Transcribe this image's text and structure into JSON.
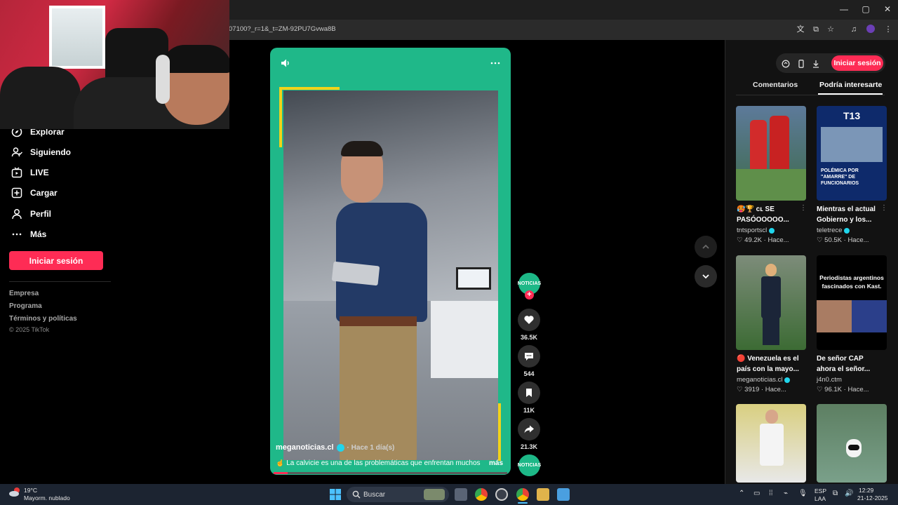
{
  "browser": {
    "url_fragment": "07100?_r=1&_t=ZM-92PU7Gvwa8B"
  },
  "sidebar": {
    "items": [
      {
        "label": "Explorar",
        "icon": "compass-icon"
      },
      {
        "label": "Siguiendo",
        "icon": "following-icon"
      },
      {
        "label": "LIVE",
        "icon": "live-icon"
      },
      {
        "label": "Cargar",
        "icon": "upload-icon"
      },
      {
        "label": "Perfil",
        "icon": "profile-icon"
      },
      {
        "label": "Más",
        "icon": "more-icon"
      }
    ],
    "login_label": "Iniciar sesión",
    "links": [
      "Empresa",
      "Programa",
      "Términos y políticas"
    ],
    "copyright": "© 2025 TikTok"
  },
  "video": {
    "author": "meganoticias.cl",
    "time": "· Hace 1 día(s)",
    "caption": "☝️ La calvicie es una de las problemáticas que enfrentan muchos",
    "more_label": "más",
    "progress": 0.06
  },
  "actions": {
    "avatar_text": "NOTICIAS",
    "likes": "36.5K",
    "comments": "544",
    "saves": "11K",
    "shares": "21.3K"
  },
  "right_panel": {
    "login_label": "Iniciar sesión",
    "tabs": [
      "Comentarios",
      "Podría interesarte"
    ],
    "active_tab": "Podría interesarte",
    "cards": [
      {
        "title": "🥵🏆 cʟ SE PASÓOOOOO...",
        "author": "tntsportscl",
        "verified": true,
        "likes": "49.2K",
        "time": "Hace..."
      },
      {
        "title": "Mientras el actual Gobierno y los...",
        "author": "teletrece",
        "verified": true,
        "likes": "50.5K",
        "time": "Hace...",
        "thumb_text": "T13",
        "thumb_banner": "POLÉMICA POR \"AMARRE\" DE FUNCIONARIOS"
      },
      {
        "title": "🔴 Venezuela es el país con la mayo...",
        "author": "meganoticias.cl",
        "verified": true,
        "likes": "3919",
        "time": "Hace..."
      },
      {
        "title": "De señor CAP ahora el señor...",
        "author": "j4n0.ctm",
        "verified": false,
        "likes": "96.1K",
        "time": "Hace...",
        "thumb_text": "Periodistas argentinos fascinados con Kast."
      }
    ]
  },
  "taskbar": {
    "weather_temp": "19°C",
    "weather_desc": "Mayorm. nublado",
    "search_label": "Buscar",
    "lang1": "ESP",
    "lang2": "LAA",
    "time": "12:29",
    "date": "21-12-2025"
  },
  "colors": {
    "accent": "#fe2c55",
    "video_bg": "#1fb889",
    "verified": "#20d5ec"
  }
}
